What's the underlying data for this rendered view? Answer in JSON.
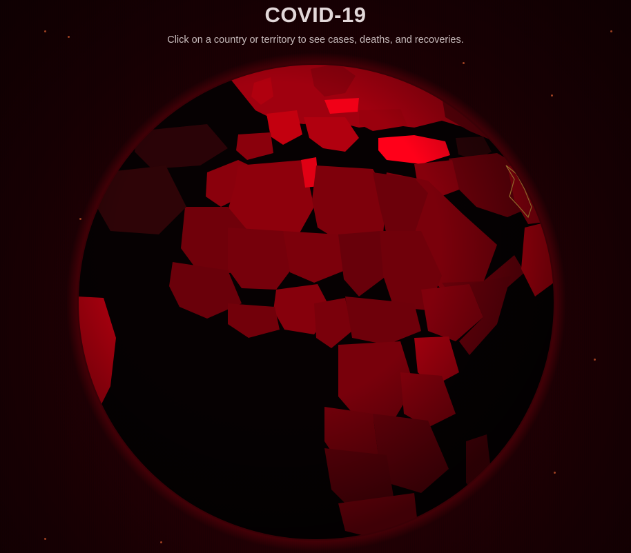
{
  "page": {
    "title": "COVID-19",
    "subtitle": "Click on a country or territory to see cases, deaths, and recoveries."
  },
  "globe": {
    "ocean_color": "#060102",
    "land_color_low": "#4a0008",
    "land_color_high": "#ff0019",
    "highlight_outline_color": "#d8a040"
  },
  "colors": {
    "background": "#1a0004",
    "accent": "#ff0019",
    "title_text": "#e2d8d9"
  }
}
